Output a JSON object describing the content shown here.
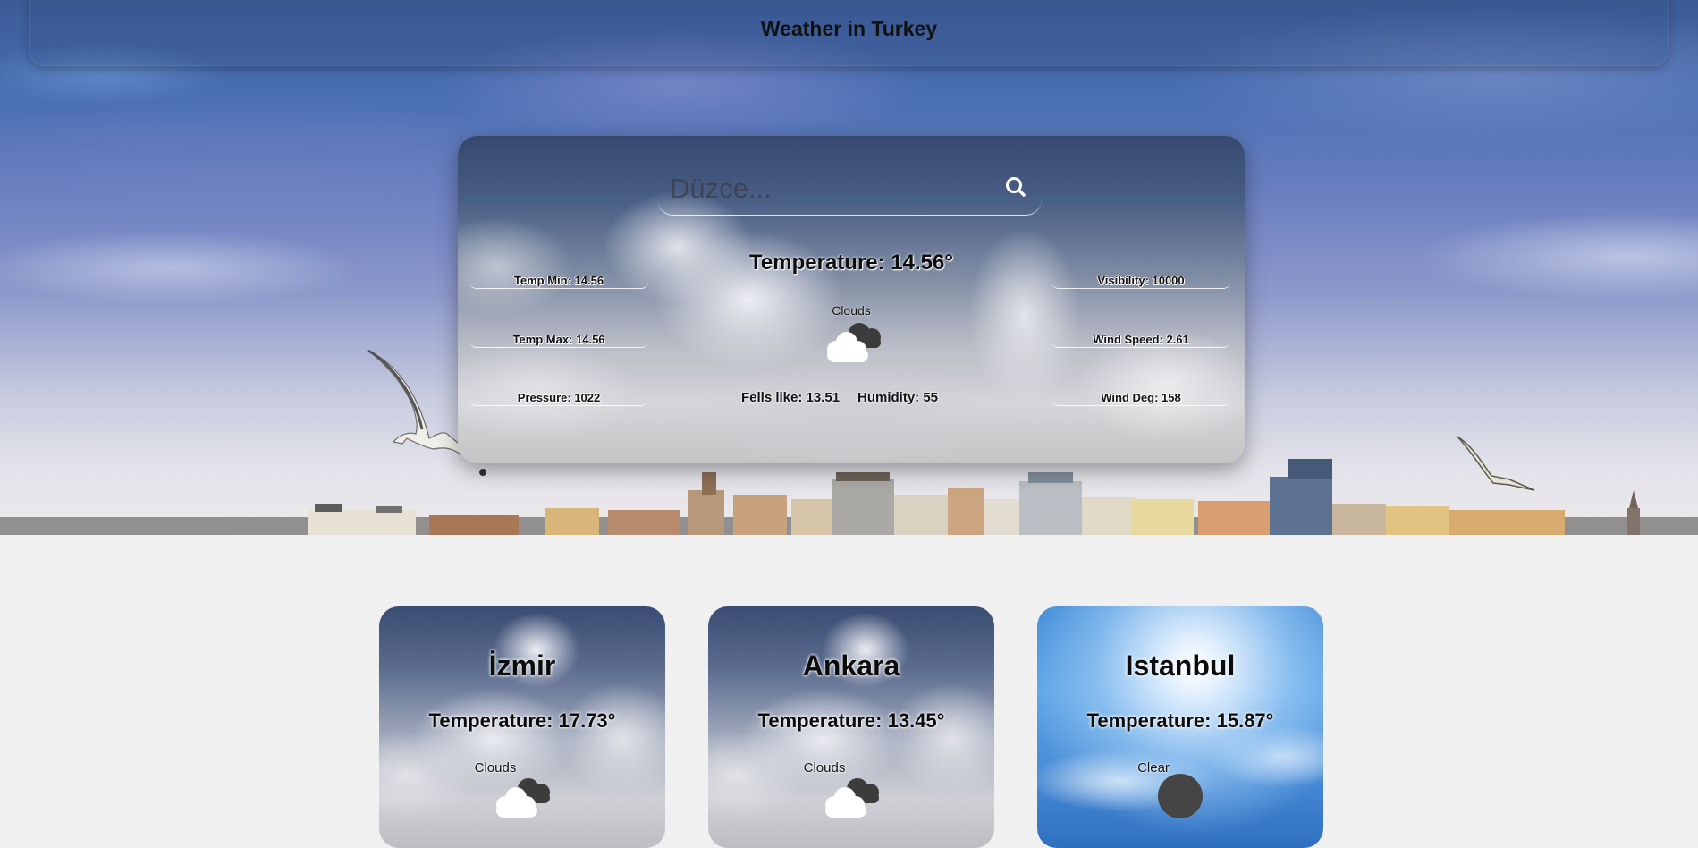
{
  "header": {
    "title": "Weather in Turkey"
  },
  "search": {
    "placeholder": "Düzce...",
    "value": ""
  },
  "current": {
    "temperature": "Temperature: 14.56°",
    "condition": "Clouds",
    "temp_min": "Temp Min: 14.56",
    "temp_max": "Temp Max: 14.56",
    "pressure": "Pressure: 1022",
    "visibility": "Visibility: 10000",
    "wind_speed": "Wind Speed: 2.61",
    "wind_deg": "Wind Deg: 158",
    "feels_like": "Fells like: 13.51",
    "humidity": "Humidity: 55",
    "icon": "clouds-icon"
  },
  "cities": [
    {
      "name": "İzmir",
      "temperature": "Temperature: 17.73°",
      "condition": "Clouds",
      "icon": "clouds-icon"
    },
    {
      "name": "Ankara",
      "temperature": "Temperature: 13.45°",
      "condition": "Clouds",
      "icon": "clouds-icon"
    },
    {
      "name": "Istanbul",
      "temperature": "Temperature: 15.87°",
      "condition": "Clear",
      "icon": "clear-icon"
    }
  ],
  "colors": {
    "page_background": "#f0f0f0",
    "clear_icon": "#454545",
    "cloud_icon_dark": "#3c3c3c"
  }
}
